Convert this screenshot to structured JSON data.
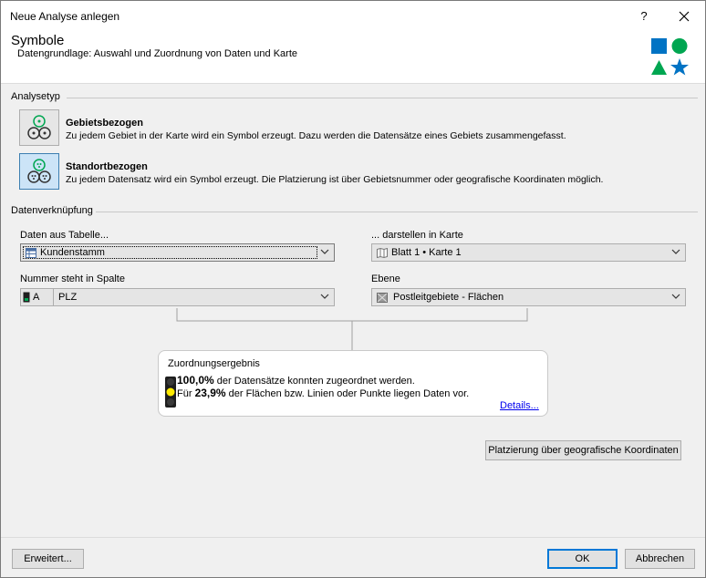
{
  "window": {
    "title": "Neue Analyse anlegen",
    "help_label": "?",
    "close_label": "✕"
  },
  "header": {
    "title": "Symbole",
    "subtitle": "Datengrundlage: Auswahl und Zuordnung von Daten und Karte",
    "colors": {
      "accent": "#0073c4",
      "green": "#00a651"
    }
  },
  "analysetyp": {
    "label": "Analysetyp",
    "options": [
      {
        "title": "Gebietsbezogen",
        "description": "Zu jedem Gebiet in der Karte wird ein Symbol erzeugt. Dazu werden die Datensätze eines Gebiets zusammengefasst.",
        "selected": false
      },
      {
        "title": "Standortbezogen",
        "description": "Zu jedem Datensatz wird ein Symbol erzeugt. Die Platzierung ist über Gebietsnummer oder geografische Koordinaten möglich.",
        "selected": true
      }
    ]
  },
  "datenverknuepfung": {
    "label": "Datenverknüpfung",
    "table_label": "Daten aus Tabelle...",
    "table_value": "Kundenstamm",
    "map_label": "... darstellen in Karte",
    "map_value": "Blatt 1 • Karte 1",
    "column_label": "Nummer steht in Spalte",
    "column_letter": "A",
    "column_value": "PLZ",
    "layer_label": "Ebene",
    "layer_value": "Postleitgebiete - Flächen"
  },
  "result": {
    "title": "Zuordnungsergebnis",
    "line1_pct": "100,0%",
    "line1_rest": " der Datensätze konnten zugeordnet werden.",
    "line2_pre": "Für ",
    "line2_pct": "23,9%",
    "line2_rest": " der Flächen bzw. Linien oder Punkte liegen Daten vor.",
    "details_link": "Details..."
  },
  "buttons": {
    "geo": "Platzierung über geografische Koordinaten",
    "advanced": "Erweitert...",
    "ok": "OK",
    "cancel": "Abbrechen"
  }
}
